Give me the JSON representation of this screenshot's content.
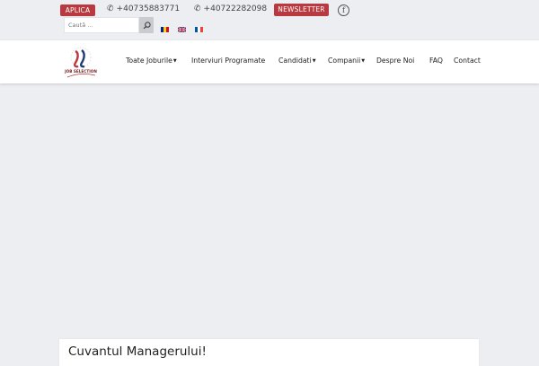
{
  "topbar": {
    "apply_label": "APLICA",
    "phone1": "+40735883771",
    "phone2": "+40722282098",
    "newsletter_label": "NEWSLETTER",
    "facebook_glyph": "f",
    "search_placeholder": "Caută ...",
    "languages": [
      "ro",
      "en",
      "fr"
    ]
  },
  "brand": {
    "logo_text": "JOB SELECTION"
  },
  "nav": {
    "items": [
      {
        "label": "Toate Joburile",
        "has_dropdown": true
      },
      {
        "label": "Interviuri Programate",
        "has_dropdown": false
      },
      {
        "label": "Candidati",
        "has_dropdown": true
      },
      {
        "label": "Companii",
        "has_dropdown": true
      },
      {
        "label": "Despre Noi",
        "has_dropdown": false
      },
      {
        "label": "FAQ",
        "has_dropdown": false
      },
      {
        "label": "Contact",
        "has_dropdown": false
      }
    ]
  },
  "main": {
    "card_title": "Cuvantul Managerului!"
  },
  "colors": {
    "accent": "#b8393f",
    "page_background": "#eceef1"
  },
  "icons": [
    "phone-icon",
    "facebook-icon",
    "search-icon",
    "chevron-down-icon"
  ]
}
